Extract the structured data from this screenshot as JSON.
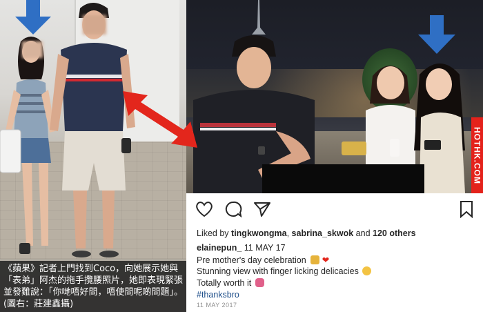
{
  "left_photo": {
    "caption": "《蘋果》記者上門找到Coco，向她展示她與「表弟」阿杰的拖手攬腰照片，她即表現緊張並發難說：「你哋唔好問，唔使問呢啲問題」。(圖右：莊建鑫攝)"
  },
  "instagram": {
    "liked_by_prefix": "Liked by ",
    "liked_user_1": "tingkwongma",
    "liked_sep": ", ",
    "liked_user_2": "sabrina_skwok",
    "liked_mid": " and ",
    "liked_count": "120 others",
    "poster": "elainepun_",
    "post_date_inline": " 11 MAY 17",
    "caption_line_1": "Pre mother's day celebration",
    "caption_line_2": "Stunning view with finger licking delicacies",
    "caption_line_3": "Totally worth it",
    "caption_line_4": "#thanksbro",
    "footer_date": "11 MAY 2017"
  },
  "watermark": "HOTHK.COM",
  "colors": {
    "highlight_arrow": "#2f6fc4",
    "link_arrow": "#e3261c",
    "watermark_bg": "#e4221b"
  },
  "icons": [
    "heart-icon",
    "comment-icon",
    "share-icon",
    "bookmark-icon"
  ]
}
